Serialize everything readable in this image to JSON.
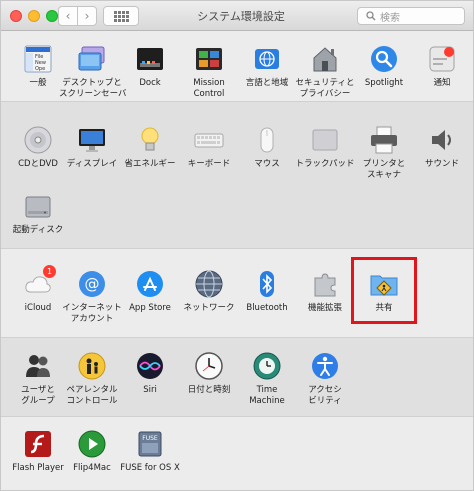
{
  "window": {
    "title": "システム環境設定"
  },
  "search": {
    "placeholder": "検索"
  },
  "sections": [
    {
      "items": [
        {
          "id": "general",
          "label": "一般",
          "icon": "general-icon"
        },
        {
          "id": "desktop",
          "label": "デスクトップと\nスクリーンセーバ",
          "icon": "desktop-icon"
        },
        {
          "id": "dock",
          "label": "Dock",
          "icon": "dock-icon"
        },
        {
          "id": "mission",
          "label": "Mission\nControl",
          "icon": "mission-control-icon"
        },
        {
          "id": "language",
          "label": "言語と地域",
          "icon": "flag-icon"
        },
        {
          "id": "security",
          "label": "セキュリティと\nプライバシー",
          "icon": "house-icon"
        },
        {
          "id": "spotlight",
          "label": "Spotlight",
          "icon": "spotlight-icon"
        },
        {
          "id": "notifications",
          "label": "通知",
          "icon": "notifications-icon"
        }
      ]
    },
    {
      "items": [
        {
          "id": "cddvd",
          "label": "CDとDVD",
          "icon": "disc-icon"
        },
        {
          "id": "displays",
          "label": "ディスプレイ",
          "icon": "display-icon"
        },
        {
          "id": "energy",
          "label": "省エネルギー",
          "icon": "bulb-icon"
        },
        {
          "id": "keyboard",
          "label": "キーボード",
          "icon": "keyboard-icon"
        },
        {
          "id": "mouse",
          "label": "マウス",
          "icon": "mouse-icon"
        },
        {
          "id": "trackpad",
          "label": "トラックパッド",
          "icon": "trackpad-icon"
        },
        {
          "id": "printers",
          "label": "プリンタと\nスキャナ",
          "icon": "printer-icon"
        },
        {
          "id": "sound",
          "label": "サウンド",
          "icon": "speaker-icon"
        },
        {
          "id": "startup",
          "label": "起動ディスク",
          "icon": "disk-icon"
        }
      ]
    },
    {
      "items": [
        {
          "id": "icloud",
          "label": "iCloud",
          "icon": "cloud-icon",
          "badge": "1"
        },
        {
          "id": "internet",
          "label": "インターネット\nアカウント",
          "icon": "at-icon"
        },
        {
          "id": "appstore",
          "label": "App Store",
          "icon": "appstore-icon"
        },
        {
          "id": "network",
          "label": "ネットワーク",
          "icon": "globe-icon"
        },
        {
          "id": "bluetooth",
          "label": "Bluetooth",
          "icon": "bluetooth-icon"
        },
        {
          "id": "extensions",
          "label": "機能拡張",
          "icon": "puzzle-icon"
        },
        {
          "id": "sharing",
          "label": "共有",
          "icon": "sharing-folder-icon"
        }
      ]
    },
    {
      "items": [
        {
          "id": "users",
          "label": "ユーザと\nグループ",
          "icon": "users-icon"
        },
        {
          "id": "parental",
          "label": "ペアレンタル\nコントロール",
          "icon": "parental-icon"
        },
        {
          "id": "siri",
          "label": "Siri",
          "icon": "siri-icon"
        },
        {
          "id": "datetime",
          "label": "日付と時刻",
          "icon": "clock-icon"
        },
        {
          "id": "timemachine",
          "label": "Time\nMachine",
          "icon": "timemachine-icon"
        },
        {
          "id": "accessibility",
          "label": "アクセシ\nビリティ",
          "icon": "accessibility-icon"
        }
      ]
    },
    {
      "items": [
        {
          "id": "flash",
          "label": "Flash Player",
          "icon": "flash-icon"
        },
        {
          "id": "flip4mac",
          "label": "Flip4Mac",
          "icon": "play-icon"
        },
        {
          "id": "fuse",
          "label": "FUSE for OS X",
          "icon": "fuse-icon",
          "icon_text": "FUSE"
        }
      ]
    }
  ],
  "general_icon_text": [
    "File",
    "New",
    "Ope"
  ],
  "colors": {
    "highlight": "#e0161c",
    "badge": "#ff3b30"
  }
}
